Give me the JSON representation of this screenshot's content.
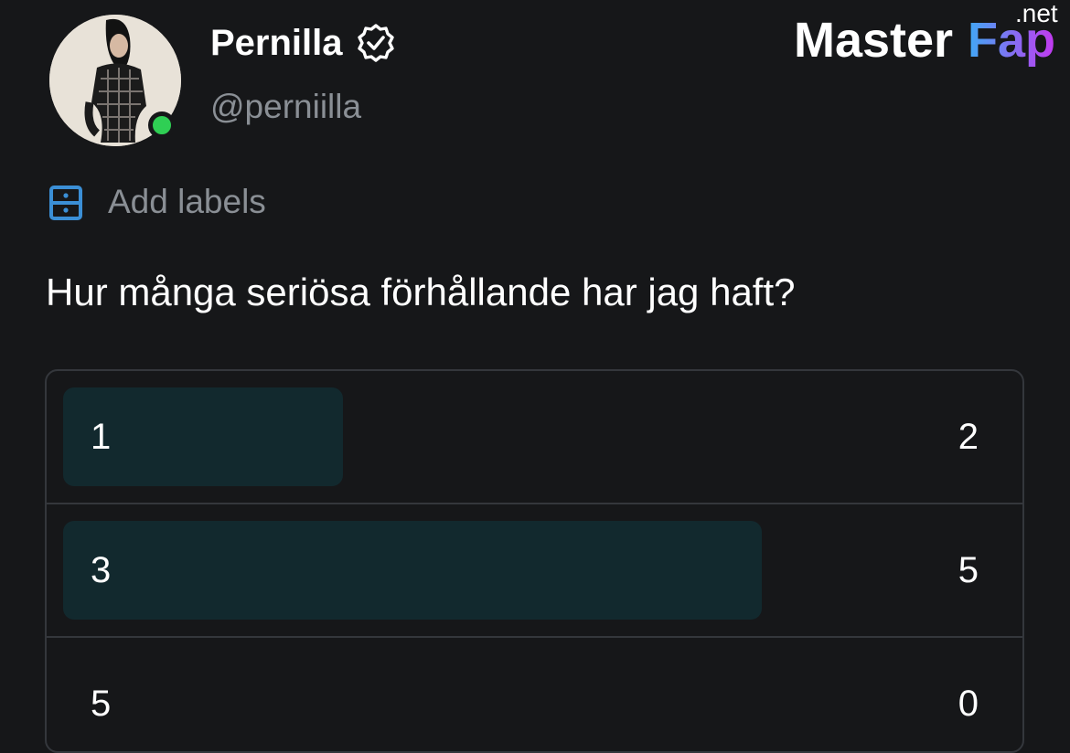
{
  "profile": {
    "name": "Pernilla",
    "handle": "@perniilla",
    "status": "online",
    "verified": true
  },
  "logo": {
    "main": "MasterFap",
    "tld": ".net"
  },
  "labels": {
    "text": "Add labels",
    "icon": "drawer-icon"
  },
  "poll": {
    "question": "Hur många seriösa förhållande har jag haft?",
    "options": [
      {
        "label": "1",
        "count": "2",
        "fill": 0.4
      },
      {
        "label": "3",
        "count": "5",
        "fill": 1.0
      },
      {
        "label": "5",
        "count": "0",
        "fill": 0.0
      }
    ]
  },
  "colors": {
    "background": "#161719",
    "bar": "#12292e",
    "accent_blue": "#3b8fd6",
    "online": "#2fcf54",
    "logo_gradient_start": "#3fa9f5",
    "logo_gradient_end": "#c438f0"
  }
}
